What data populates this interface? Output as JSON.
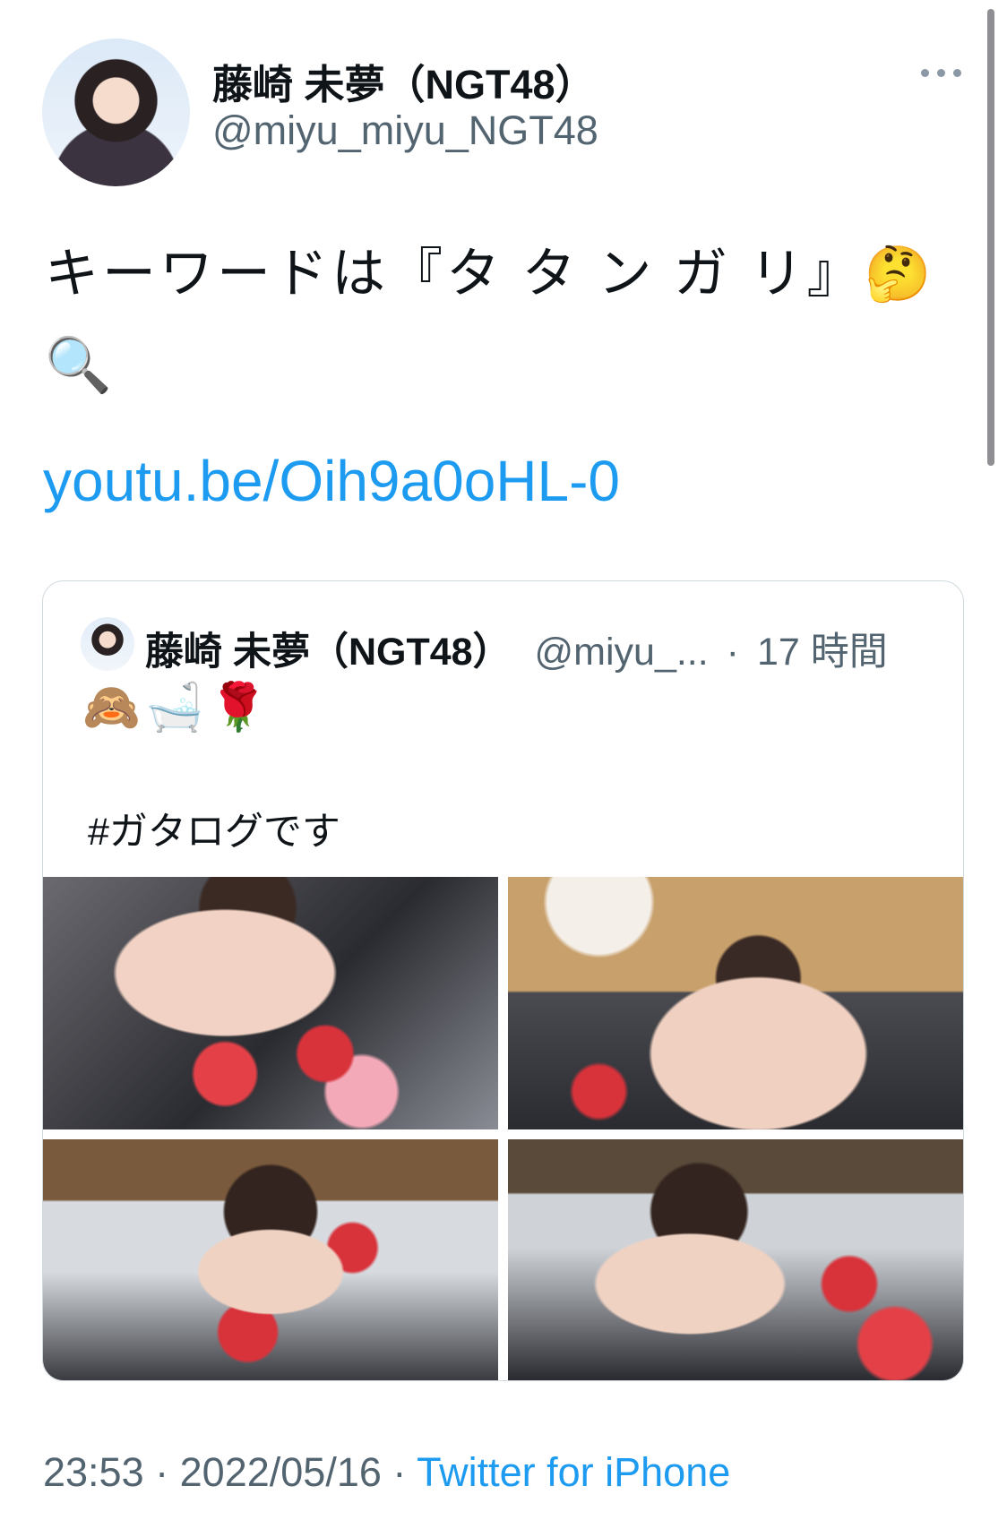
{
  "author": {
    "display_name": "藤崎 未夢（NGT48）",
    "handle": "@miyu_miyu_NGT48"
  },
  "tweet": {
    "text": "キーワードは『タ タ ン ガ リ』🤔",
    "emoji_line": "🔍",
    "link": "youtu.be/Oih9a0oHL-0"
  },
  "quoted": {
    "display_name": "藤崎 未夢（NGT48）",
    "handle_truncated": "@miyu_...",
    "separator": "·",
    "time_ago": "17 時間",
    "emojis": "🙈🛁🌹",
    "hashtag_text": "#ガタログです"
  },
  "footer": {
    "time": "23:53",
    "sep1": "·",
    "date": "2022/05/16",
    "sep2": "·",
    "source": "Twitter for iPhone"
  },
  "icons": {
    "more": "more-horizontal-icon"
  },
  "colors": {
    "link": "#1d9bf0",
    "secondary": "#536471",
    "border": "#cfd9de"
  }
}
